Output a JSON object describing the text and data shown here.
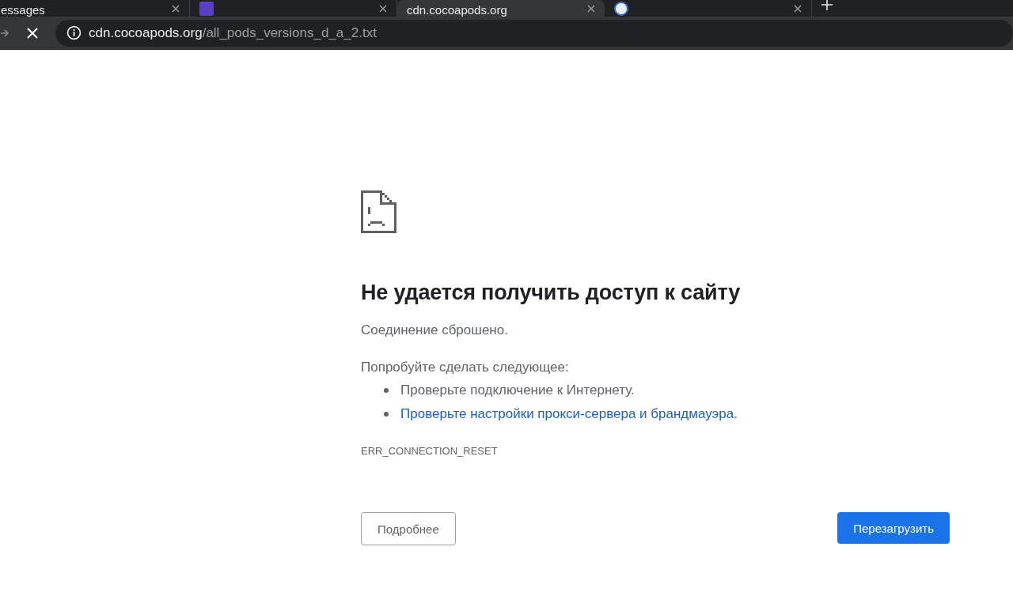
{
  "tabs": [
    {
      "title": "essages",
      "selected": false
    },
    {
      "selected": false
    },
    {
      "title": "cdn.cocoapods.org",
      "selected": true
    },
    {
      "selected": false
    }
  ],
  "toolbar": {
    "url_host": "cdn.cocoapods.org",
    "url_path": "/all_pods_versions_d_a_2.txt"
  },
  "error": {
    "heading": "Не удается получить доступ к сайту",
    "message": "Соединение сброшено.",
    "suggestions_title": "Попробуйте сделать следующее:",
    "suggestions": [
      {
        "text": "Проверьте подключение к Интернету.",
        "kind": "text"
      },
      {
        "text": "Проверьте настройки прокси-сервера и брандмауэра.",
        "kind": "link"
      }
    ],
    "code": "ERR_CONNECTION_RESET",
    "details_button": "Подробнее",
    "reload_button": "Перезагрузить"
  }
}
